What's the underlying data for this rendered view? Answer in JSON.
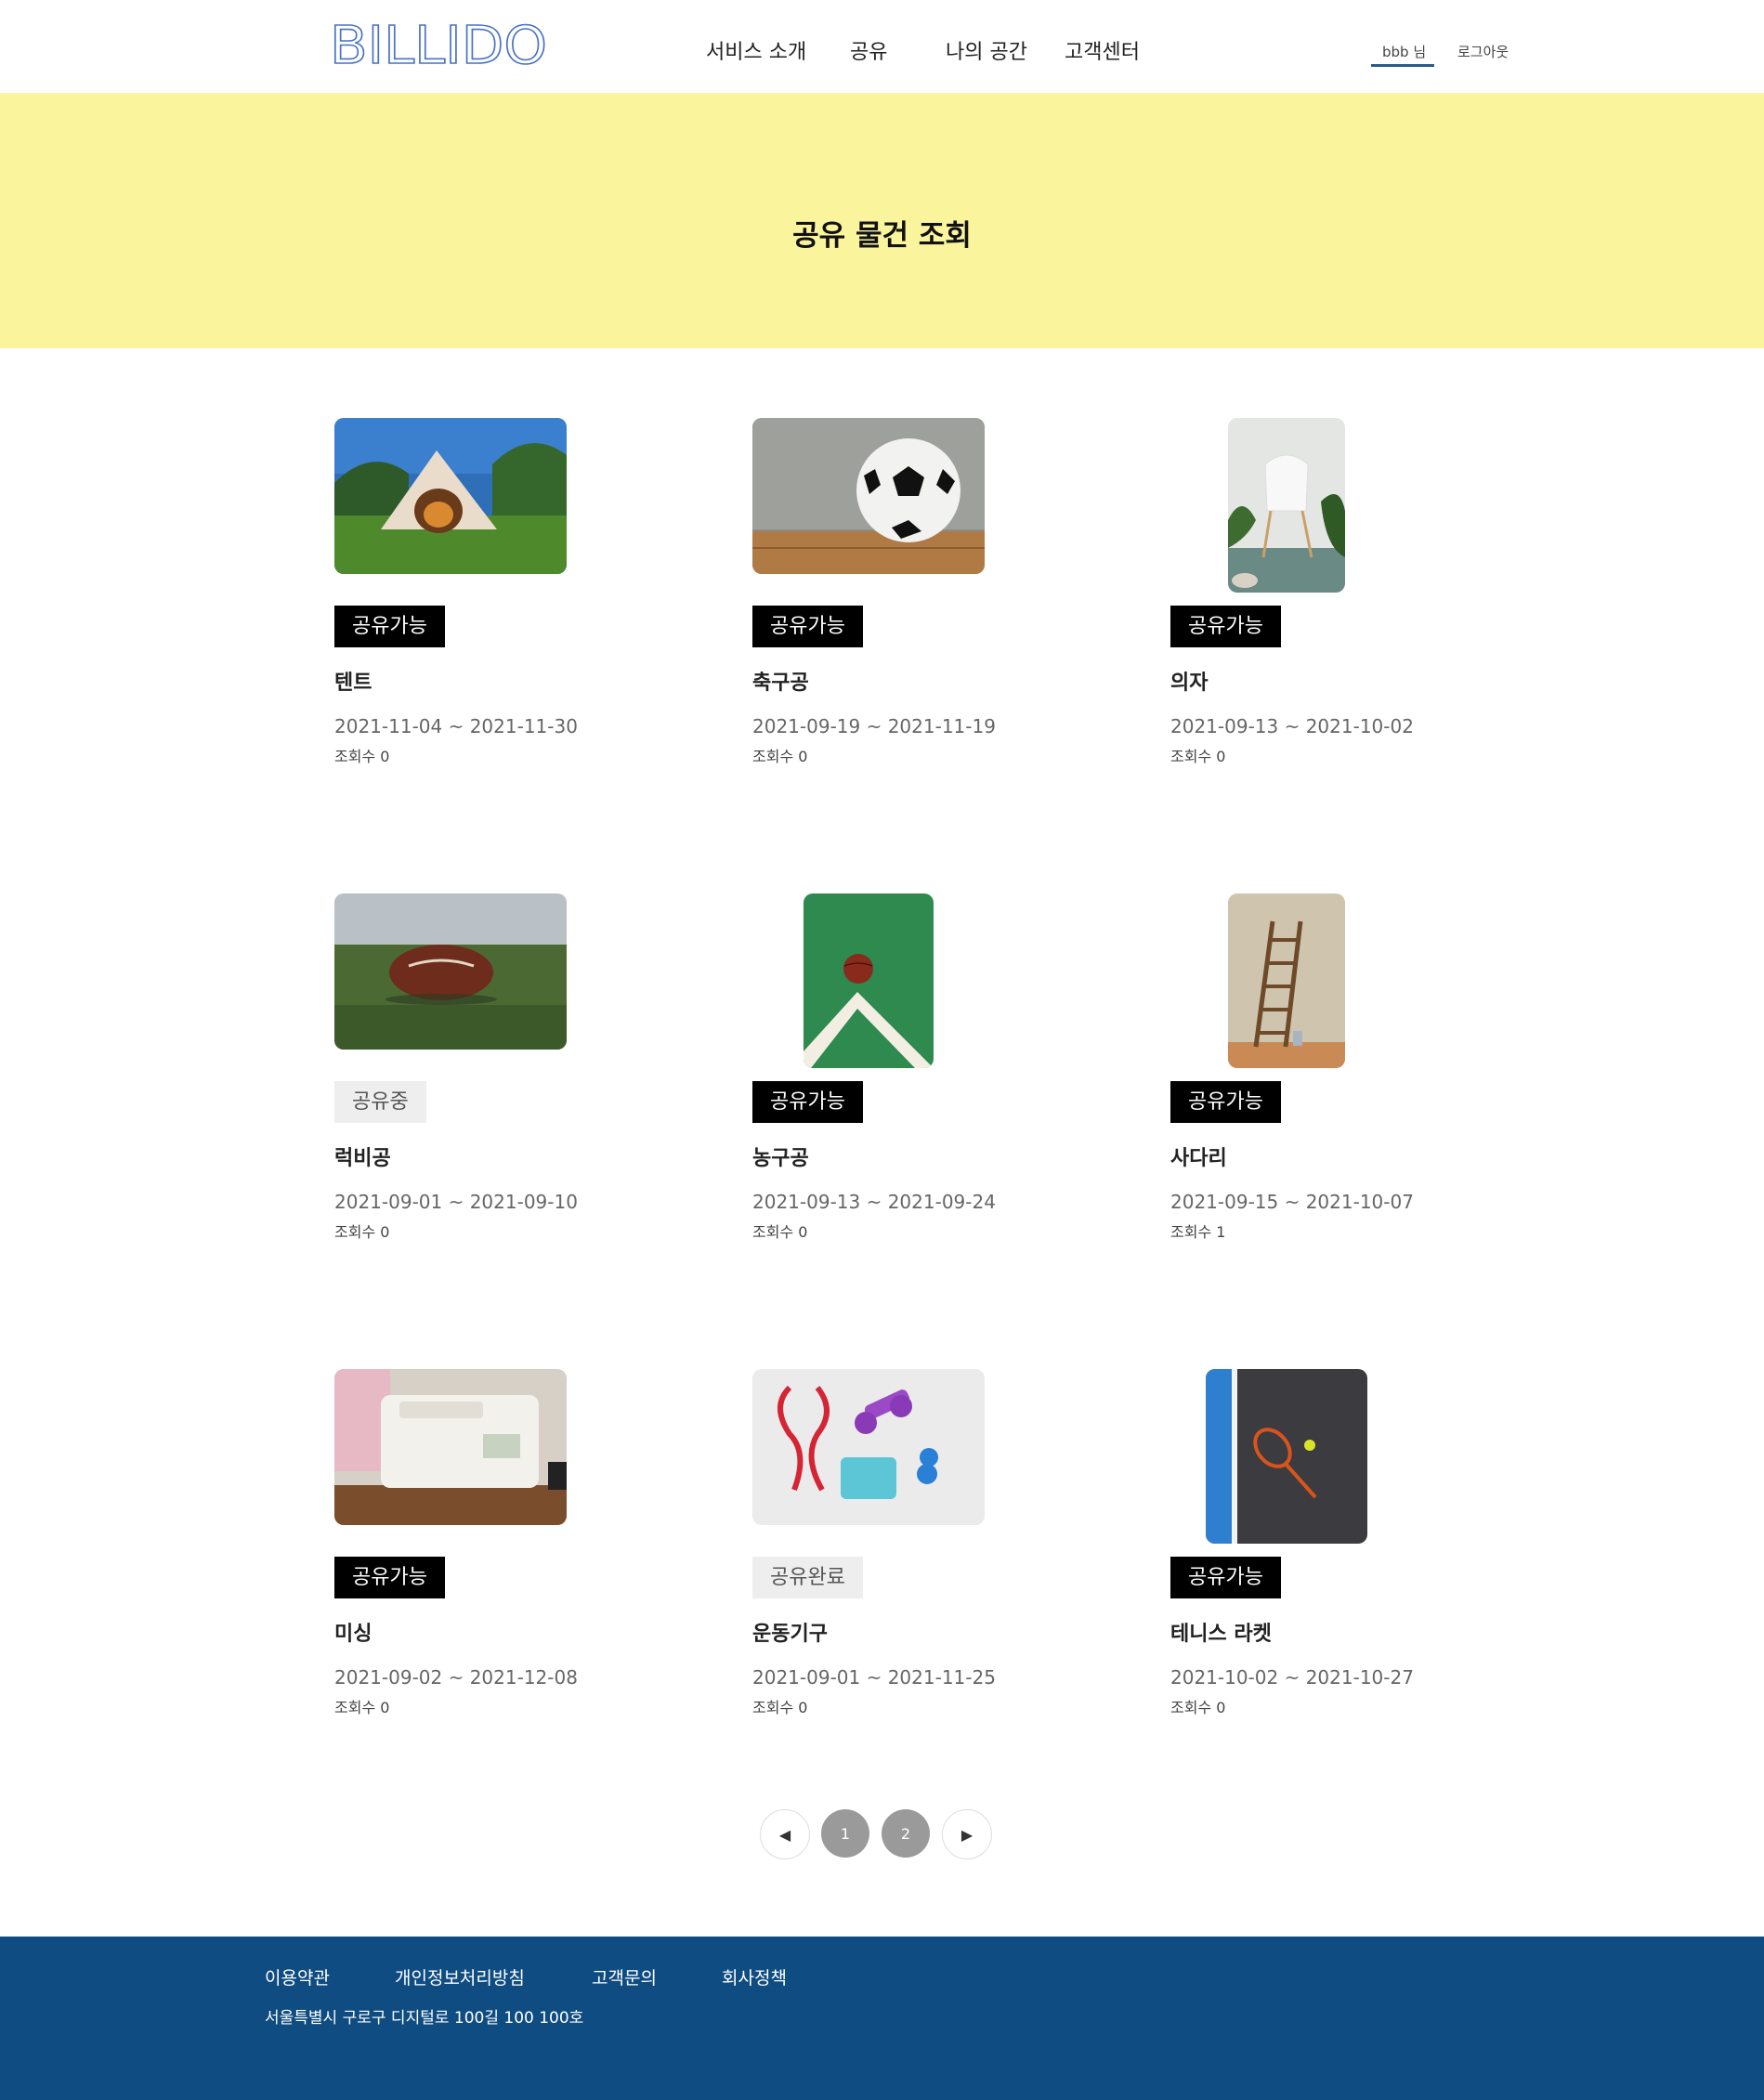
{
  "header": {
    "logo_text": "BILLIDO",
    "nav": [
      "서비스 소개",
      "공유",
      "나의 공간",
      "고객센터"
    ],
    "user_name": "bbb 님",
    "logout": "로그아웃",
    "accent": "#2a5a8a"
  },
  "hero": {
    "title": "공유 물건 조회",
    "background": "#faf59d"
  },
  "items": [
    {
      "status": "공유가능",
      "status_type": "available",
      "name": "텐트",
      "dates": "2021-11-04 ~ 2021-11-30",
      "views": "조회수 0",
      "image": "tent-photo"
    },
    {
      "status": "공유가능",
      "status_type": "available",
      "name": "축구공",
      "dates": "2021-09-19 ~ 2021-11-19",
      "views": "조회수 0",
      "image": "soccer-ball-photo"
    },
    {
      "status": "공유가능",
      "status_type": "available",
      "name": "의자",
      "dates": "2021-09-13 ~ 2021-10-02",
      "views": "조회수 0",
      "image": "chair-photo"
    },
    {
      "status": "공유중",
      "status_type": "sharing",
      "name": "럭비공",
      "dates": "2021-09-01 ~ 2021-09-10",
      "views": "조회수 0",
      "image": "rugby-ball-photo"
    },
    {
      "status": "공유가능",
      "status_type": "available",
      "name": "농구공",
      "dates": "2021-09-13 ~ 2021-09-24",
      "views": "조회수 0",
      "image": "basketball-photo"
    },
    {
      "status": "공유가능",
      "status_type": "available",
      "name": "사다리",
      "dates": "2021-09-15 ~ 2021-10-07",
      "views": "조회수 1",
      "image": "ladder-photo"
    },
    {
      "status": "공유가능",
      "status_type": "available",
      "name": "미싱",
      "dates": "2021-09-02 ~ 2021-12-08",
      "views": "조회수 0",
      "image": "sewing-machine-photo"
    },
    {
      "status": "공유완료",
      "status_type": "done",
      "name": "운동기구",
      "dates": "2021-09-01 ~ 2021-11-25",
      "views": "조회수 0",
      "image": "exercise-equipment-photo"
    },
    {
      "status": "공유가능",
      "status_type": "available",
      "name": "테니스 라켓",
      "dates": "2021-10-02 ~ 2021-10-27",
      "views": "조회수 0",
      "image": "tennis-racket-photo"
    }
  ],
  "pagination": {
    "prev": "◀",
    "pages": [
      "1",
      "2"
    ],
    "next": "▶"
  },
  "footer": {
    "links": [
      "이용약관",
      "개인정보처리방침",
      "고객문의",
      "회사정책"
    ],
    "address": "서울특별시 구로구 디지털로 100길 100 100호",
    "background": "#0f4c81"
  }
}
